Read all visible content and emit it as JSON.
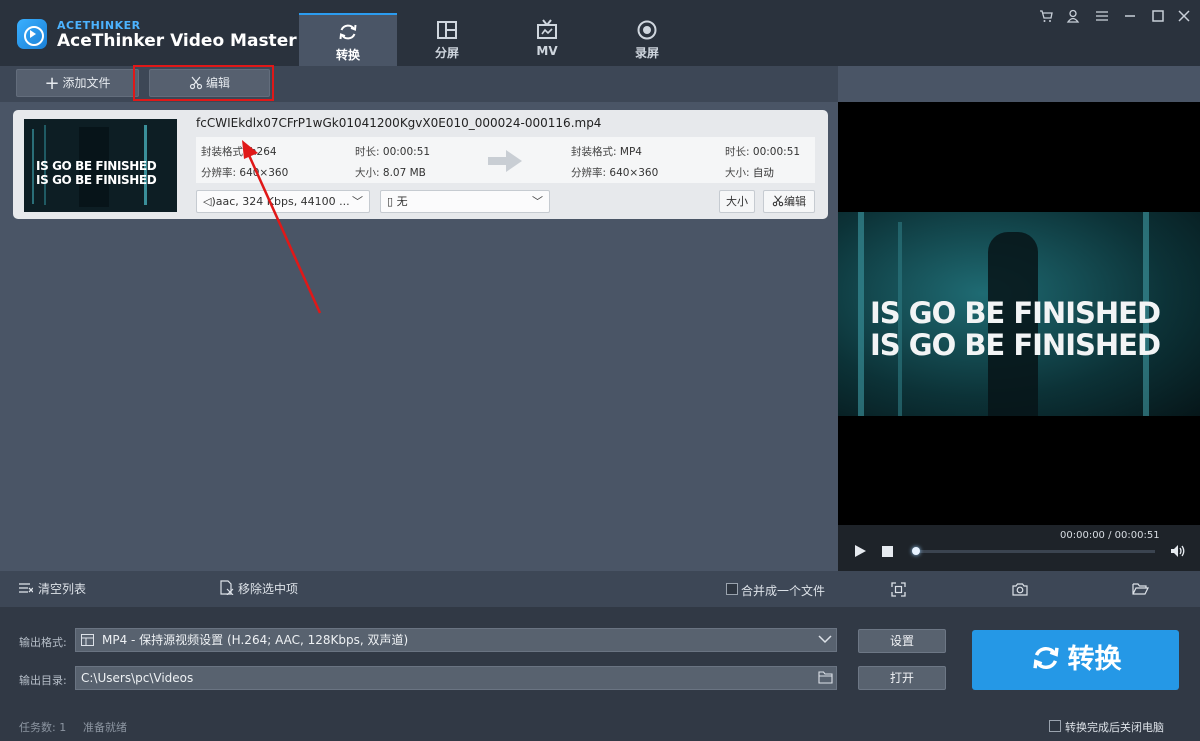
{
  "app": {
    "brand_small": "ACETHINKER",
    "title": "AceThinker Video Master"
  },
  "nav": [
    {
      "label": "转换",
      "icon": "refresh-icon",
      "active": true
    },
    {
      "label": "分屏",
      "icon": "split-screen-icon",
      "active": false
    },
    {
      "label": "MV",
      "icon": "tv-icon",
      "active": false
    },
    {
      "label": "录屏",
      "icon": "record-icon",
      "active": false
    }
  ],
  "toolbar": {
    "add_file": "添加文件",
    "edit": "编辑"
  },
  "file": {
    "name": "fcCWIEkdlx07CFrP1wGk01041200KgvX0E010_000024-000116.mp4",
    "thumb_line1": "IS GO BE FINISHED",
    "thumb_line2": "IS GO BE FINISHED",
    "src_format_key": "封装格式:",
    "src_format": "h264",
    "src_duration_key": "时长:",
    "src_duration": "00:00:51",
    "src_resolution_key": "分辨率:",
    "src_resolution": "640×360",
    "src_size_key": "大小:",
    "src_size": "8.07 MB",
    "out_format_key": "封装格式:",
    "out_format": "MP4",
    "out_duration_key": "时长:",
    "out_duration": "00:00:51",
    "out_resolution_key": "分辨率:",
    "out_resolution": "640×360",
    "out_size_key": "大小:",
    "out_size": "自动",
    "audio_track": "aac, 324 Kbps, 44100 ...",
    "subtitle": "无",
    "size_button": "大小",
    "edit_button": "编辑"
  },
  "preview": {
    "line1": "IS GO BE FINISHED",
    "line2": "IS GO BE FINISHED",
    "time": "00:00:00 / 00:00:51",
    "progress": 0
  },
  "listbar": {
    "clear": "清空列表",
    "remove": "移除选中项",
    "merge": "合并成一个文件"
  },
  "output": {
    "format_label": "输出格式:",
    "format_value": "MP4 - 保持源视频设置 (H.264; AAC, 128Kbps, 双声道)",
    "settings_button": "设置",
    "dir_label": "输出目录:",
    "dir_value": "C:\\Users\\pc\\Videos",
    "open_button": "打开",
    "convert_button": "转换"
  },
  "status": {
    "tasks": "任务数: 1",
    "state": "准备就绪",
    "shutdown": "转换完成后关闭电脑"
  },
  "colors": {
    "accent": "#2598e6",
    "highlight": "#e01818"
  }
}
